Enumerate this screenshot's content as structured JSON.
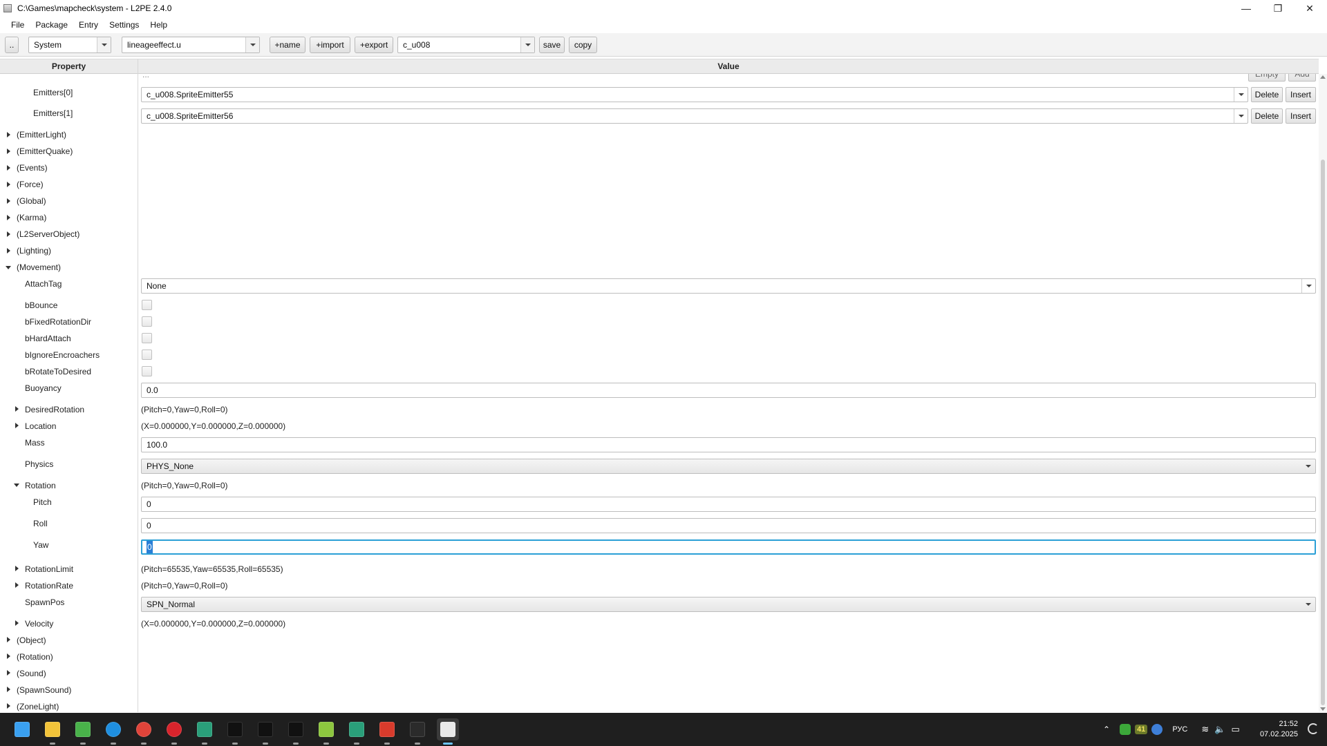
{
  "window": {
    "title": "C:\\Games\\mapcheck\\system - L2PE 2.4.0",
    "minimize": "—",
    "maximize": "❐",
    "close": "✕"
  },
  "menu": [
    "File",
    "Package",
    "Entry",
    "Settings",
    "Help"
  ],
  "toolbar": {
    "up_label": "..",
    "folder_value": "System",
    "package_value": "lineageeffect.u",
    "add_name": "+name",
    "add_import": "+import",
    "add_export": "+export",
    "entry_value": "c_u008",
    "save": "save",
    "copy": "copy"
  },
  "header": {
    "property": "Property",
    "value": "Value"
  },
  "partial_top": {
    "ellipsis": "...",
    "empty": "Empty",
    "add": "Add"
  },
  "emitters": [
    {
      "label": "Emitters[0]",
      "value": "c_u008.SpriteEmitter55",
      "delete": "Delete",
      "insert": "Insert"
    },
    {
      "label": "Emitters[1]",
      "value": "c_u008.SpriteEmitter56",
      "delete": "Delete",
      "insert": "Insert"
    }
  ],
  "groups_top": [
    "(EmitterLight)",
    "(EmitterQuake)",
    "(Events)",
    "(Force)",
    "(Global)",
    "(Karma)",
    "(L2ServerObject)",
    "(Lighting)"
  ],
  "movement": {
    "label": "(Movement)",
    "attach_tag": {
      "label": "AttachTag",
      "value": "None"
    },
    "checks": [
      {
        "label": "bBounce",
        "checked": false
      },
      {
        "label": "bFixedRotationDir",
        "checked": false
      },
      {
        "label": "bHardAttach",
        "checked": false
      },
      {
        "label": "bIgnoreEncroachers",
        "checked": false
      },
      {
        "label": "bRotateToDesired",
        "checked": false
      }
    ],
    "buoyancy": {
      "label": "Buoyancy",
      "value": "0.0"
    },
    "desired_rotation": {
      "label": "DesiredRotation",
      "value": "(Pitch=0,Yaw=0,Roll=0)"
    },
    "location": {
      "label": "Location",
      "value": "(X=0.000000,Y=0.000000,Z=0.000000)"
    },
    "mass": {
      "label": "Mass",
      "value": "100.0"
    },
    "physics": {
      "label": "Physics",
      "value": "PHYS_None"
    },
    "rotation": {
      "label": "Rotation",
      "value": "(Pitch=0,Yaw=0,Roll=0)",
      "pitch": {
        "label": "Pitch",
        "value": "0"
      },
      "roll": {
        "label": "Roll",
        "value": "0"
      },
      "yaw": {
        "label": "Yaw",
        "value": "0"
      }
    },
    "rotation_limit": {
      "label": "RotationLimit",
      "value": "(Pitch=65535,Yaw=65535,Roll=65535)"
    },
    "rotation_rate": {
      "label": "RotationRate",
      "value": "(Pitch=0,Yaw=0,Roll=0)"
    },
    "spawn_pos": {
      "label": "SpawnPos",
      "value": "SPN_Normal"
    },
    "velocity": {
      "label": "Velocity",
      "value": "(X=0.000000,Y=0.000000,Z=0.000000)"
    }
  },
  "groups_bottom": [
    "(Object)",
    "(Rotation)",
    "(Sound)",
    "(SpawnSound)",
    "(ZoneLight)"
  ],
  "taskbar": {
    "apps": [
      {
        "name": "start-icon",
        "color": "#3aa0f0"
      },
      {
        "name": "file-explorer-icon",
        "color": "#f2c33a"
      },
      {
        "name": "notepad-plus-icon",
        "color": "#49b24a"
      },
      {
        "name": "edge-icon",
        "color": "#1f8fe0"
      },
      {
        "name": "chrome-icon",
        "color": "#e0443a"
      },
      {
        "name": "opera-icon",
        "color": "#d8242c"
      },
      {
        "name": "unreal-icon",
        "color": "#2a9f7a"
      },
      {
        "name": "unrealed-icon-1",
        "color": "#111111"
      },
      {
        "name": "unrealed-icon-2",
        "color": "#111111"
      },
      {
        "name": "unrealed-icon-3",
        "color": "#111111"
      },
      {
        "name": "editor-icon",
        "color": "#8dc63f"
      },
      {
        "name": "unreal-icon-2",
        "color": "#2a9f7a"
      },
      {
        "name": "red-app-icon",
        "color": "#d83b2c"
      },
      {
        "name": "terminal-icon",
        "color": "#2b2b2b"
      },
      {
        "name": "java-app-icon",
        "color": "#e8e8e8"
      }
    ],
    "tray": {
      "language": "РУС",
      "badge": "41"
    },
    "time": "21:52",
    "date": "07.02.2025"
  }
}
